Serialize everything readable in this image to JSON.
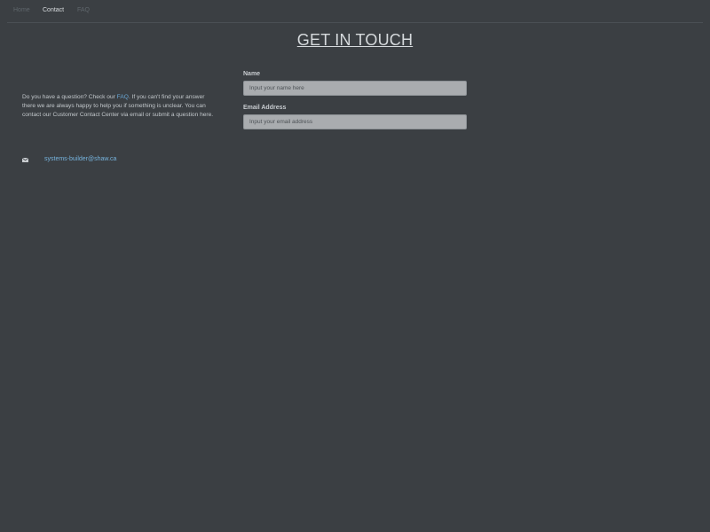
{
  "nav": {
    "items": [
      {
        "label": "Home"
      },
      {
        "label": "Contact"
      },
      {
        "label": "FAQ"
      }
    ]
  },
  "page": {
    "title": "GET IN TOUCH"
  },
  "intro": {
    "before_link": "Do you have a question? Check our ",
    "link_text": "FAQ",
    "after_link": ". If you can't find your answer there we are always happy to help you if something is unclear.  You can contact our Customer Contact Center via email or submit a question here."
  },
  "contact": {
    "icon": "envelope-icon",
    "email": "systems-builder@shaw.ca"
  },
  "form": {
    "name_label": "Name",
    "name_placeholder": "Input your name here",
    "name_value": "",
    "email_label": "Email Address",
    "email_placeholder": "Input your email address",
    "email_value": ""
  },
  "colors": {
    "background": "#3b3f43",
    "link": "#6aa9d8",
    "input_bg": "#a9acaf"
  }
}
